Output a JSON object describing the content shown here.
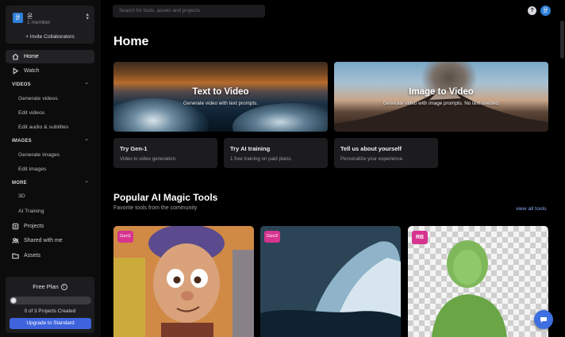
{
  "workspace": {
    "avatar_initial": "윤",
    "name": "윤",
    "members": "1 member",
    "invite_label": "+ Invite Collaborators"
  },
  "nav": {
    "home": "Home",
    "watch": "Watch",
    "videos_header": "VIDEOS",
    "videos_items": [
      "Generate videos",
      "Edit videos",
      "Edit audio & subtitles"
    ],
    "images_header": "IMAGES",
    "images_items": [
      "Generate images",
      "Edit images"
    ],
    "more_header": "MORE",
    "more_items": [
      "3D",
      "AI Training"
    ],
    "projects": "Projects",
    "shared": "Shared with me",
    "assets": "Assets"
  },
  "plan": {
    "title": "Free Plan",
    "info_glyph": "i",
    "projects_created": 0,
    "projects_limit": 3,
    "count_text": "0 of 3 Projects Created",
    "upgrade_label": "Upgrade to Standard"
  },
  "topbar": {
    "search_placeholder": "Search for tools, assets and projects",
    "help_glyph": "?",
    "user_initial": "윤"
  },
  "page_title": "Home",
  "heroes": [
    {
      "title": "Text to Video",
      "subtitle": "Generate video with text prompts."
    },
    {
      "title": "Image to Video",
      "subtitle": "Generate video with image prompts. No text needed."
    }
  ],
  "mini_cards": [
    {
      "title": "Try Gen-1",
      "subtitle": "Video to video generation."
    },
    {
      "title": "Try AI training",
      "subtitle": "1 free training on paid plans."
    },
    {
      "title": "Tell us about yourself",
      "subtitle": "Personalize your experience."
    }
  ],
  "popular": {
    "title": "Popular AI Magic Tools",
    "subtitle": "Favorite tools from the community",
    "view_all": "view all tools",
    "tools": [
      {
        "badge": "Gen1"
      },
      {
        "badge": "Gen2"
      },
      {
        "badge": "RB"
      }
    ]
  }
}
